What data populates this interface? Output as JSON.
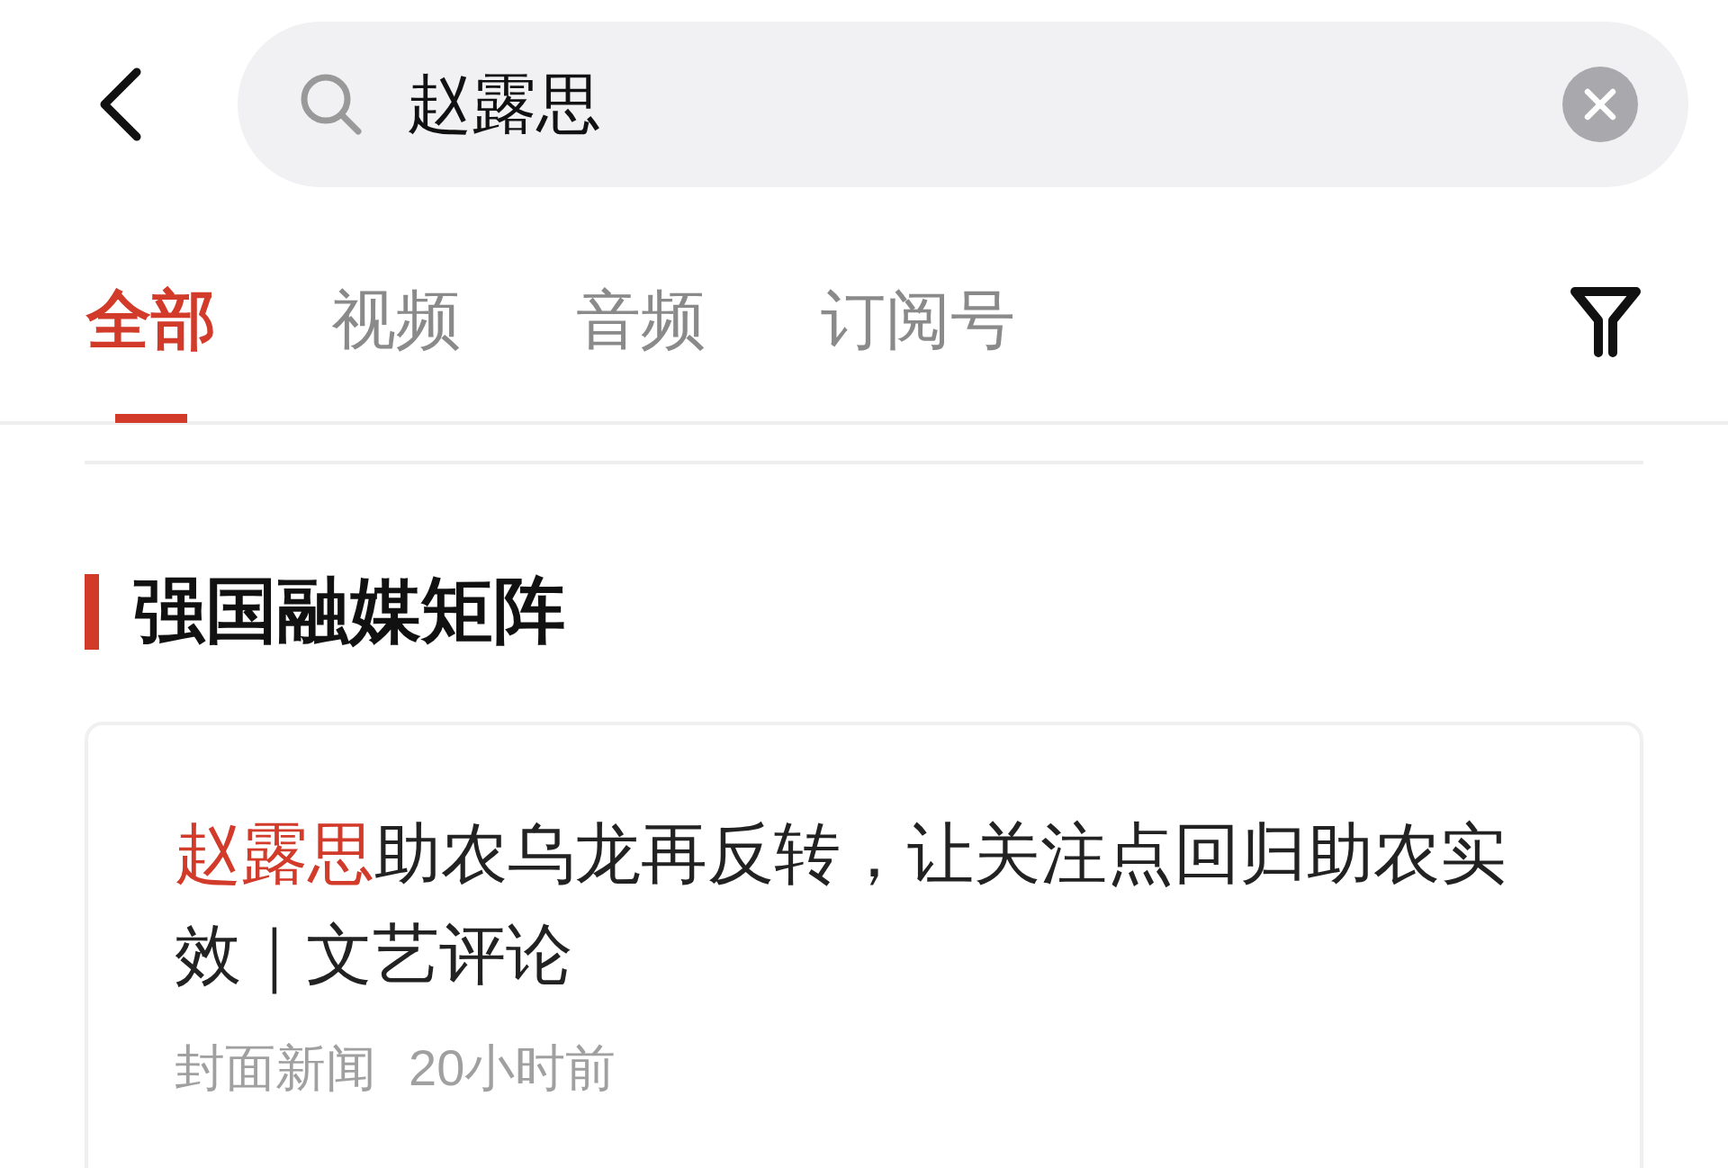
{
  "search": {
    "value": "赵露思"
  },
  "tabs": [
    {
      "label": "全部",
      "selected": true
    },
    {
      "label": "视频",
      "selected": false
    },
    {
      "label": "音频",
      "selected": false
    },
    {
      "label": "订阅号",
      "selected": false
    }
  ],
  "section": {
    "title": "强国融媒矩阵"
  },
  "articles": [
    {
      "title_highlight": "赵露思",
      "title_rest": "助农乌龙再反转，让关注点回归助农实效｜文艺评论",
      "source": "封面新闻",
      "time": "20小时前"
    }
  ]
}
